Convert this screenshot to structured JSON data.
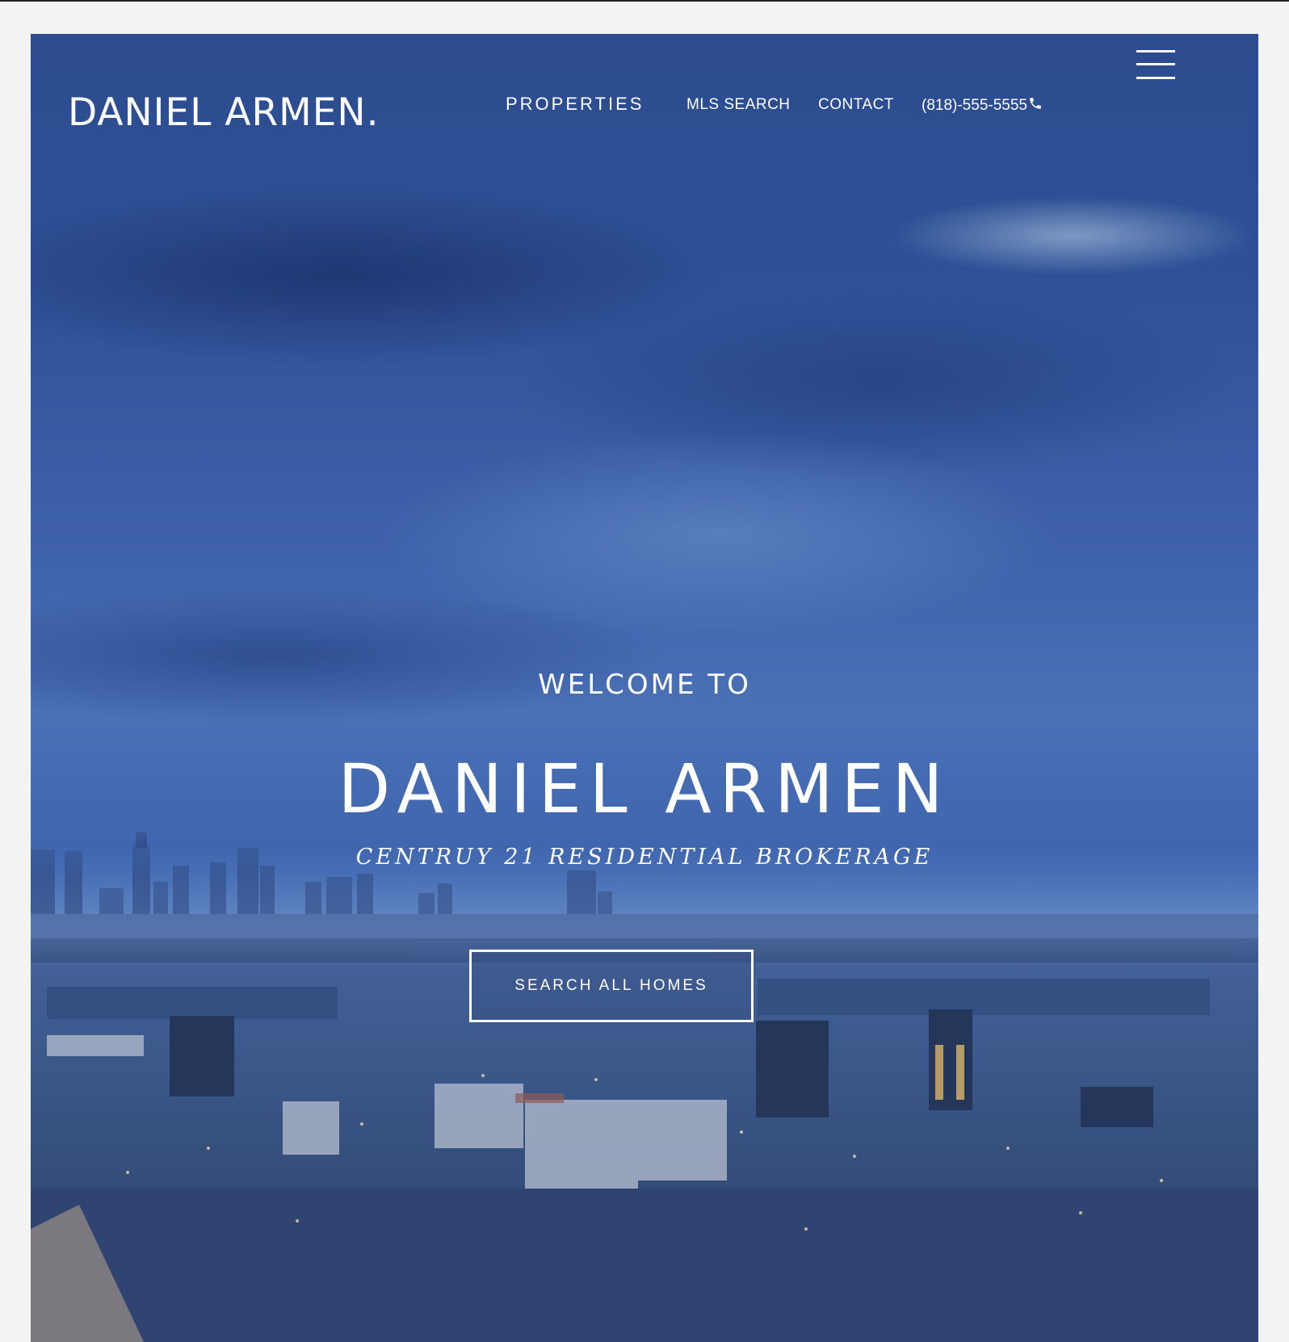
{
  "header": {
    "brand": "DANIEL ARMEN.",
    "nav": {
      "properties": "PROPERTIES",
      "mls_search": "MLS SEARCH",
      "contact": "CONTACT",
      "phone": "(818)-555-5555"
    },
    "menu_icon": "hamburger-menu-icon",
    "phone_icon": "phone-icon"
  },
  "hero": {
    "welcome": "WELCOME TO",
    "title": "DANIEL ARMEN",
    "subtitle": "CENTRUY 21 RESIDENTIAL BROKERAGE",
    "cta": "SEARCH ALL HOMES",
    "background": "cloudy-city-skyline-image"
  },
  "colors": {
    "page_bg": "#f3f3f3",
    "sky_dark": "#2c4c8e",
    "sky_light": "#6d93cc",
    "text": "#ffffff"
  }
}
